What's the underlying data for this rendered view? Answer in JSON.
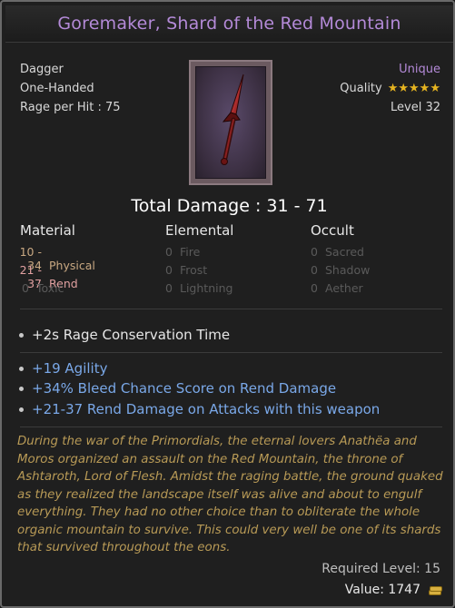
{
  "item": {
    "name": "Goremaker, Shard of the Red Mountain",
    "type": "Dagger",
    "handedness": "One-Handed",
    "rage_per_hit": "Rage per Hit : 75",
    "rarity": "Unique",
    "quality_label": "Quality",
    "quality_stars": "★★★★★",
    "level": "Level 32"
  },
  "damage": {
    "total": "Total Damage : 31 - 71",
    "columns": [
      "Material",
      "Elemental",
      "Occult"
    ],
    "material": [
      {
        "value": "10 - 34",
        "name": "Physical"
      },
      {
        "value": "21 - 37",
        "name": "Rend"
      },
      {
        "value": "0",
        "name": "Toxic"
      }
    ],
    "elemental": [
      {
        "value": "0",
        "name": "Fire"
      },
      {
        "value": "0",
        "name": "Frost"
      },
      {
        "value": "0",
        "name": "Lightning"
      }
    ],
    "occult": [
      {
        "value": "0",
        "name": "Sacred"
      },
      {
        "value": "0",
        "name": "Shadow"
      },
      {
        "value": "0",
        "name": "Aether"
      }
    ]
  },
  "implicit": "+2s Rage Conservation Time",
  "affixes": [
    "+19 Agility",
    "+34% Bleed Chance Score on Rend Damage",
    "+21-37 Rend Damage on Attacks with this weapon"
  ],
  "lore": "During the war of the Primordials, the eternal lovers Anathëa and Moros organized an assault on the Red Mountain, the throne of Ashtaroth, Lord of Flesh. Amidst the raging battle, the ground quaked as they realized the landscape itself was alive and about to engulf everything. They had no other choice than to obliterate the whole organic mountain to survive. This could very well be one of its shards that survived throughout the eons.",
  "footer": {
    "required_level": "Required Level: 15",
    "value": "Value: 1747"
  },
  "colors": {
    "title": "#b48ad8",
    "affix_blue": "#7aa8e8",
    "lore_gold": "#b89a56",
    "stars": "#e6b420"
  },
  "icons": {
    "weapon": "dagger-icon",
    "currency": "gold-coins-icon"
  }
}
